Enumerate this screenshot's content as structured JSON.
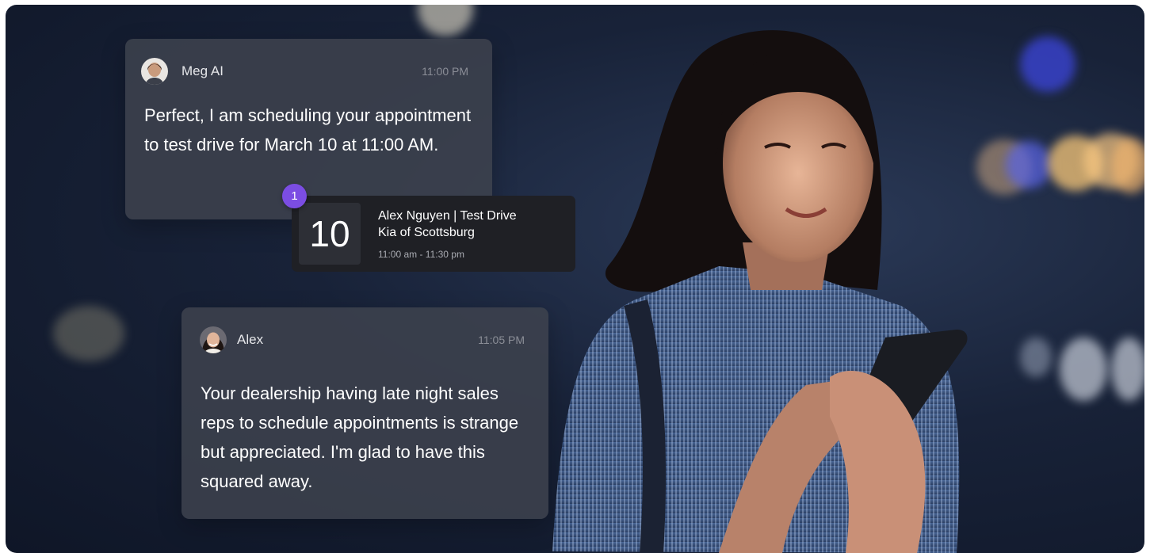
{
  "messages": {
    "meg": {
      "sender": "Meg AI",
      "time": "11:00 PM",
      "text": "Perfect, I am scheduling your appointment to test drive for March 10 at 11:00 AM."
    },
    "alex": {
      "sender": "Alex",
      "time": "11:05 PM",
      "text": "Your dealership having late night sales reps to schedule appointments is strange but appreciated. I'm glad to have this squared away."
    }
  },
  "appointment": {
    "badge_count": "1",
    "day": "10",
    "title": "Alex Nguyen | Test Drive",
    "location": "Kia of Scottsburg",
    "time_range": "11:00 am - 11:30 pm"
  },
  "colors": {
    "badge": "#7b4de3",
    "card_bg": "#3e424e",
    "appointment_bg": "#1f2025"
  }
}
